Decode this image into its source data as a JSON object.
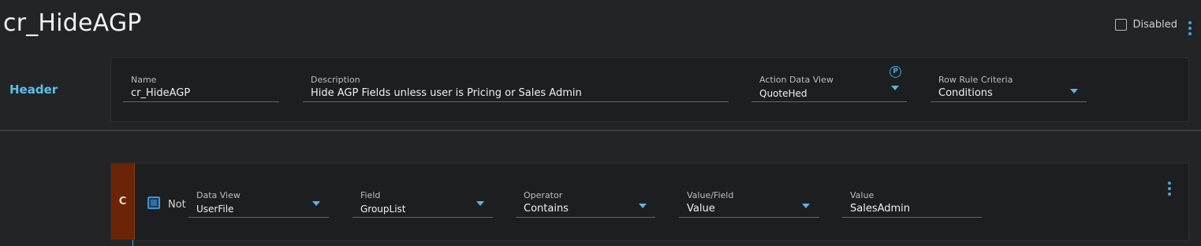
{
  "page": {
    "title": "cr_HideAGP",
    "disabled_label": "Disabled",
    "disabled_checked": false
  },
  "header_section": {
    "label": "Header",
    "fields": {
      "name": {
        "label": "Name",
        "value": "cr_HideAGP"
      },
      "description": {
        "label": "Description",
        "value": "Hide AGP Fields unless user is Pricing or Sales Admin"
      },
      "action_data_view": {
        "label": "Action Data View",
        "value": "QuoteHed",
        "badge": "P"
      },
      "row_rule_criteria": {
        "label": "Row Rule Criteria",
        "value": "Conditions"
      }
    }
  },
  "condition": {
    "tag": "C",
    "not_label": "Not",
    "not_checked": true,
    "fields": {
      "data_view": {
        "label": "Data View",
        "value": "UserFile"
      },
      "field": {
        "label": "Field",
        "value": "GroupList"
      },
      "operator": {
        "label": "Operator",
        "value": "Contains"
      },
      "value_field": {
        "label": "Value/Field",
        "value": "Value"
      },
      "value": {
        "label": "Value",
        "value": "SalesAdmin"
      }
    }
  },
  "colors": {
    "background": "#232425",
    "card": "#1d1e1f",
    "accent": "#4aa3df",
    "section_label": "#5bc0eb",
    "condition_tag": "#6b2406"
  },
  "icons": {
    "more": "vertical-ellipsis-icon",
    "dropdown": "chevron-down-icon",
    "badge": "p-circle-icon"
  }
}
